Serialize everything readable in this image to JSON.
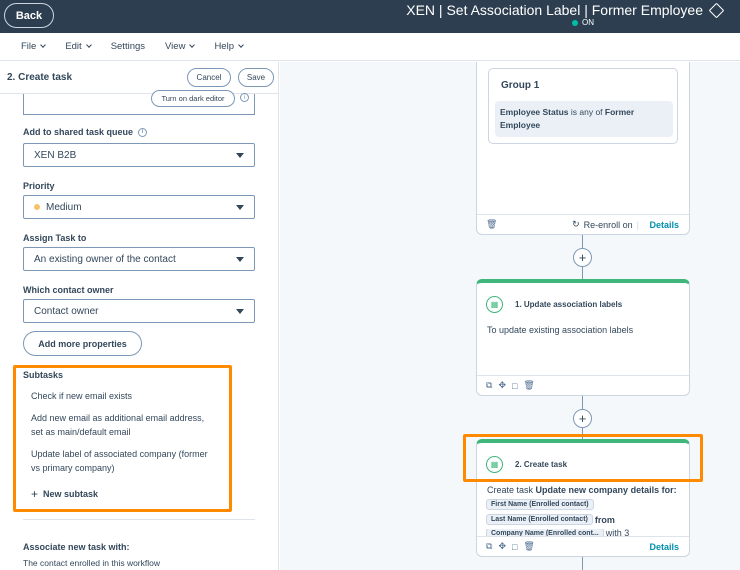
{
  "topbar": {
    "back_label": "Back",
    "workflow_title": "XEN | Set Association Label | Former Employee",
    "status": "ON"
  },
  "menu": {
    "items": [
      "File",
      "Edit",
      "Settings",
      "View",
      "Help"
    ]
  },
  "panel": {
    "title": "2. Create task",
    "cancel_label": "Cancel",
    "save_label": "Save",
    "dark_editor_label": "Turn on dark editor",
    "queue_label": "Add to shared task queue",
    "queue_value": "XEN B2B",
    "priority_label": "Priority",
    "priority_value": "Medium",
    "assign_label": "Assign Task to",
    "assign_value": "An existing owner of the contact",
    "owner_label": "Which contact owner",
    "owner_value": "Contact owner",
    "more_props_label": "Add more properties",
    "subtasks_title": "Subtasks",
    "subtasks": [
      "Check if new email exists",
      "Add new email as additional email address, set as main/default email",
      "Update label of associated company (former vs primary company)"
    ],
    "new_subtask_label": "New subtask",
    "associate_title": "Associate new task with:",
    "associate_value": "The contact enrolled in this workflow"
  },
  "canvas": {
    "group_title": "Group 1",
    "group_cond_prop": "Employee Status",
    "group_cond_op": "is any of",
    "group_cond_val": "Former Employee",
    "reenroll_label": "Re-enroll on",
    "details_label": "Details",
    "action1_title": "1. Update association labels",
    "action1_desc": "To update existing association labels",
    "action2_title": "2. Create task",
    "action2_prefix": "Create task",
    "action2_bold": "Update new company details for:",
    "token_first": "First Name (Enrolled contact)",
    "token_last": "Last Name (Enrolled contact)",
    "token_from": "from",
    "token_company": "Company Name (Enrolled cont...",
    "token_with": "with 3",
    "action2_details": "Details"
  },
  "colors": {
    "topbar": "#2d3e50",
    "accent_green": "#3fb77a",
    "highlight_orange": "#ff8a00",
    "link": "#0091ae"
  }
}
